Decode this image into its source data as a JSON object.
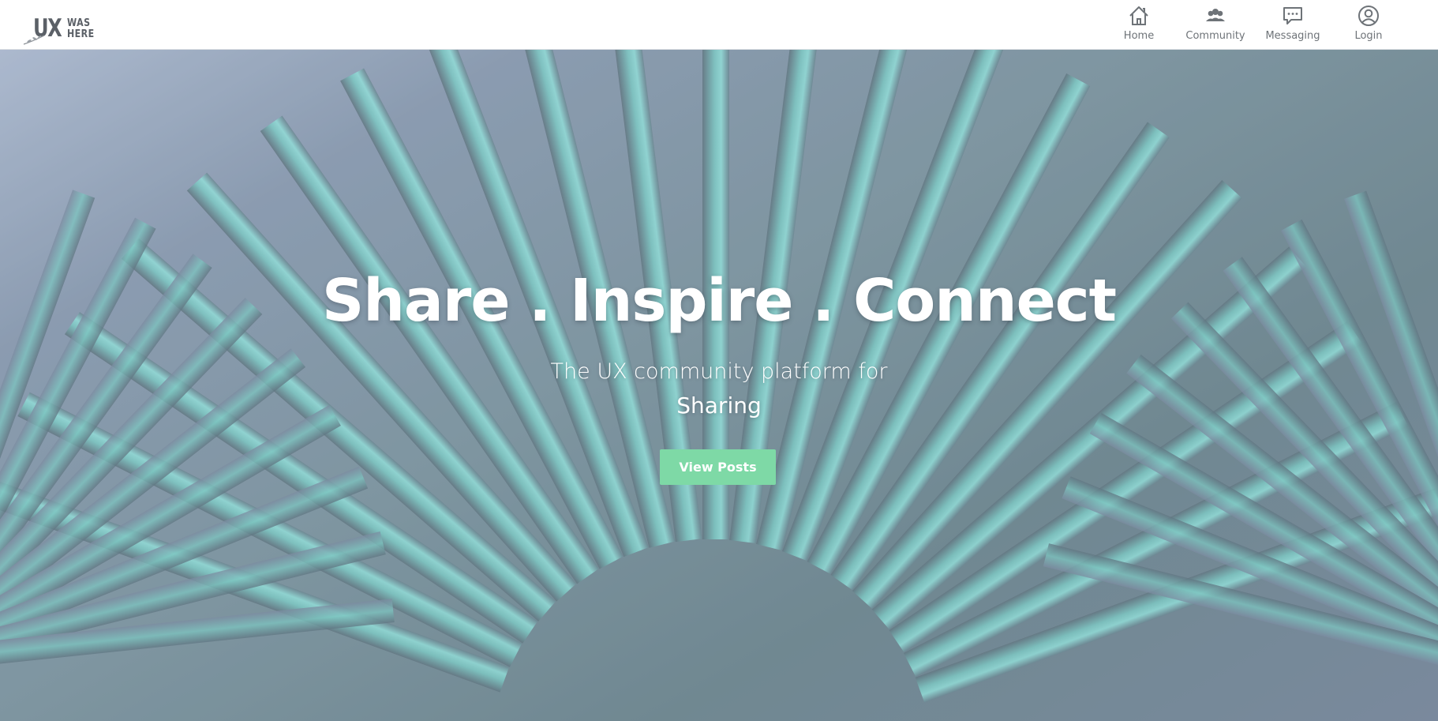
{
  "brand": {
    "logo_main": "UX",
    "logo_line1": "WAS",
    "logo_line2": "HERE"
  },
  "nav": {
    "items": [
      {
        "label": "Home",
        "icon": "home-icon"
      },
      {
        "label": "Community",
        "icon": "community-icon"
      },
      {
        "label": "Messaging",
        "icon": "messaging-icon"
      },
      {
        "label": "Login",
        "icon": "user-icon"
      }
    ]
  },
  "hero": {
    "headline": "Share . Inspire . Connect",
    "tagline": "The UX community platform for",
    "rotating_word": "Sharing",
    "cta_label": "View Posts"
  },
  "colors": {
    "accent": "#7ed9a6",
    "nav_text": "#6e7378",
    "hero_teal": "#8ff0e6"
  }
}
